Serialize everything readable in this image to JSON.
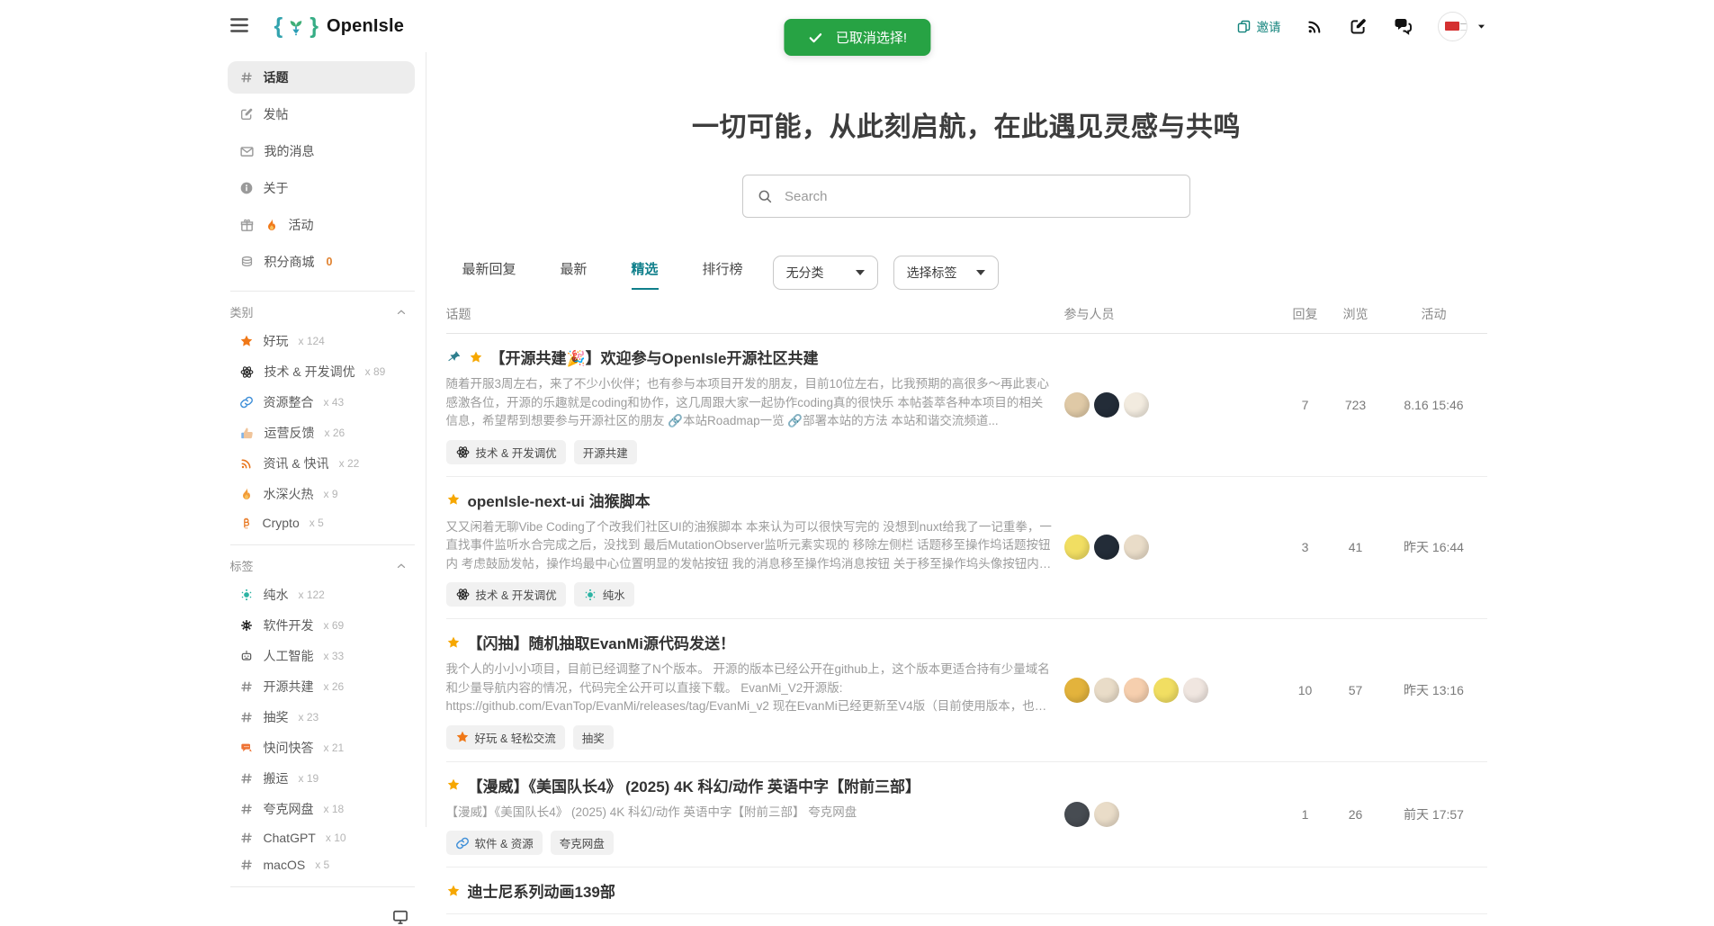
{
  "header": {
    "brand": "OpenIsle",
    "invite_label": "邀请",
    "toast_label": "已取消选择!"
  },
  "sidebar": {
    "nav": [
      {
        "icon": "hash",
        "label": "话题",
        "active": true
      },
      {
        "icon": "compose",
        "label": "发帖"
      },
      {
        "icon": "mail",
        "label": "我的消息"
      },
      {
        "icon": "info",
        "label": "关于"
      },
      {
        "icon": "gift",
        "label": "活动",
        "fire": true
      },
      {
        "icon": "coins",
        "label": "积分商城",
        "badge": "0"
      }
    ],
    "categories_title": "类别",
    "categories": [
      {
        "icon": "star",
        "color": "#f07818",
        "label": "好玩",
        "count": "x 124"
      },
      {
        "icon": "atom",
        "color": "#222222",
        "label": "技术 & 开发调优",
        "count": "x 89"
      },
      {
        "icon": "link",
        "color": "#3f8fd8",
        "label": "资源整合",
        "count": "x 43"
      },
      {
        "icon": "thumbs",
        "color": "#7fb3e8",
        "label": "运营反馈",
        "count": "x 26"
      },
      {
        "icon": "rss",
        "color": "#e8761e",
        "label": "资讯 & 快讯",
        "count": "x 22"
      },
      {
        "icon": "flame",
        "color": "#f29b38",
        "label": "水深火热",
        "count": "x 9"
      },
      {
        "icon": "bitcoin",
        "color": "#e8761e",
        "label": "Crypto",
        "count": "x 5"
      }
    ],
    "tags_title": "标签",
    "tags": [
      {
        "icon": "water",
        "color": "#2bb3a3",
        "label": "纯水",
        "count": "x 122"
      },
      {
        "icon": "gearcode",
        "color": "#1a1a1a",
        "label": "软件开发",
        "count": "x 69"
      },
      {
        "icon": "robot",
        "color": "#555555",
        "label": "人工智能",
        "count": "x 33"
      },
      {
        "icon": "hash",
        "color": "#8a8a8a",
        "label": "开源共建",
        "count": "x 26"
      },
      {
        "icon": "hash",
        "color": "#8a8a8a",
        "label": "抽奖",
        "count": "x 23"
      },
      {
        "icon": "chat",
        "color": "#ee7233",
        "label": "快问快答",
        "count": "x 21"
      },
      {
        "icon": "hash",
        "color": "#8a8a8a",
        "label": "搬运",
        "count": "x 19"
      },
      {
        "icon": "hash",
        "color": "#8a8a8a",
        "label": "夸克网盘",
        "count": "x 18"
      },
      {
        "icon": "hash",
        "color": "#8a8a8a",
        "label": "ChatGPT",
        "count": "x 10"
      },
      {
        "icon": "hash",
        "color": "#8a8a8a",
        "label": "macOS",
        "count": "x 5"
      }
    ]
  },
  "main": {
    "hero_title": "一切可能，从此刻启航，在此遇见灵感与共鸣",
    "search_placeholder": "Search",
    "tabs": [
      {
        "label": "最新回复"
      },
      {
        "label": "最新"
      },
      {
        "label": "精选",
        "active": true
      },
      {
        "label": "排行榜"
      }
    ],
    "filters": {
      "category": "无分类",
      "tag": "选择标签"
    },
    "columns": {
      "topic": "话题",
      "participants": "参与人员",
      "replies": "回复",
      "views": "浏览",
      "activity": "活动"
    },
    "topics": [
      {
        "pinned": true,
        "title": "【开源共建🎉】欢迎参与OpenIsle开源社区共建",
        "excerpt": "随着开服3周左右，来了不少小伙伴；也有参与本项目开发的朋友，目前10位左右，比我预期的高很多～再此衷心感激各位，开源的乐趣就是coding和协作，这几周跟大家一起协作coding真的很快乐 本帖荟萃各种本项目的相关信息，希望帮到想要参与开源社区的朋友 🔗本站Roadmap一览 🔗部署本站的方法 本站和谐交流频道...",
        "tags": [
          {
            "icon": "atom",
            "color": "#222222",
            "label": "技术 & 开发调优"
          },
          {
            "label": "开源共建"
          }
        ],
        "avatars": [
          "#dfc9a6",
          "#232c38",
          "#f2ebdf"
        ],
        "replies": "7",
        "views": "723",
        "activity": "8.16 15:46"
      },
      {
        "title": "openIsle-next-ui 油猴脚本",
        "excerpt": "又又闲着无聊Vibe Coding了个改我们社区UI的油猴脚本 本来认为可以很快写完的 没想到nuxt给我了一记重拳，一直找事件监听水合完成之后，没找到 最后MutationObserver监听元素实现的 移除左侧栏 话题移至操作坞话题按钮内 考虑鼓励发帖，操作坞最中心位置明显的发帖按钮 我的消息移至操作坞消息按钮 关于移至操作坞头像按钮内折叠（...",
        "tags": [
          {
            "icon": "atom",
            "color": "#222222",
            "label": "技术 & 开发调优"
          },
          {
            "icon": "water",
            "color": "#2bb3a3",
            "label": "纯水"
          }
        ],
        "avatars": [
          "#f1de62",
          "#232c38",
          "#e9dcc8"
        ],
        "replies": "3",
        "views": "41",
        "activity": "昨天 16:44"
      },
      {
        "title": "【闪抽】随机抽取EvanMi源代码发送！",
        "excerpt": "我个人的小小小项目，目前已经调整了N个版本。 开源的版本已经公开在github上，这个版本更适合持有少量域名和少量导航内容的情况，代码完全公开可以直接下载。 EvanMi_V2开源版: https://github.com/EvanTop/EvanMi/releases/tag/EvanMi_v2 现在EvanMi已经更新至V4版（目前使用版本，也是...",
        "tags": [
          {
            "icon": "star",
            "color": "#f07818",
            "label": "好玩 & 轻松交流"
          },
          {
            "label": "抽奖"
          }
        ],
        "avatars": [
          "#e3b33c",
          "#e9dcc8",
          "#f6cfae",
          "#f1de62",
          "#f0e6e0"
        ],
        "replies": "10",
        "views": "57",
        "activity": "昨天 13:16"
      },
      {
        "title": "【漫威】《美国队长4》 (2025) 4K 科幻/动作 英语中字【附前三部】",
        "excerpt": "【漫威】《美国队长4》 (2025) 4K 科幻/动作 英语中字【附前三部】 夸克网盘",
        "tags": [
          {
            "icon": "link",
            "color": "#3f8fd8",
            "label": "软件 & 资源"
          },
          {
            "label": "夸克网盘"
          }
        ],
        "avatars": [
          "#474c52",
          "#e9dcc8"
        ],
        "replies": "1",
        "views": "26",
        "activity": "前天 17:57"
      },
      {
        "title": "迪士尼系列动画139部",
        "excerpt": "",
        "tags": [],
        "avatars": [],
        "replies": "",
        "views": "",
        "activity": ""
      }
    ]
  }
}
